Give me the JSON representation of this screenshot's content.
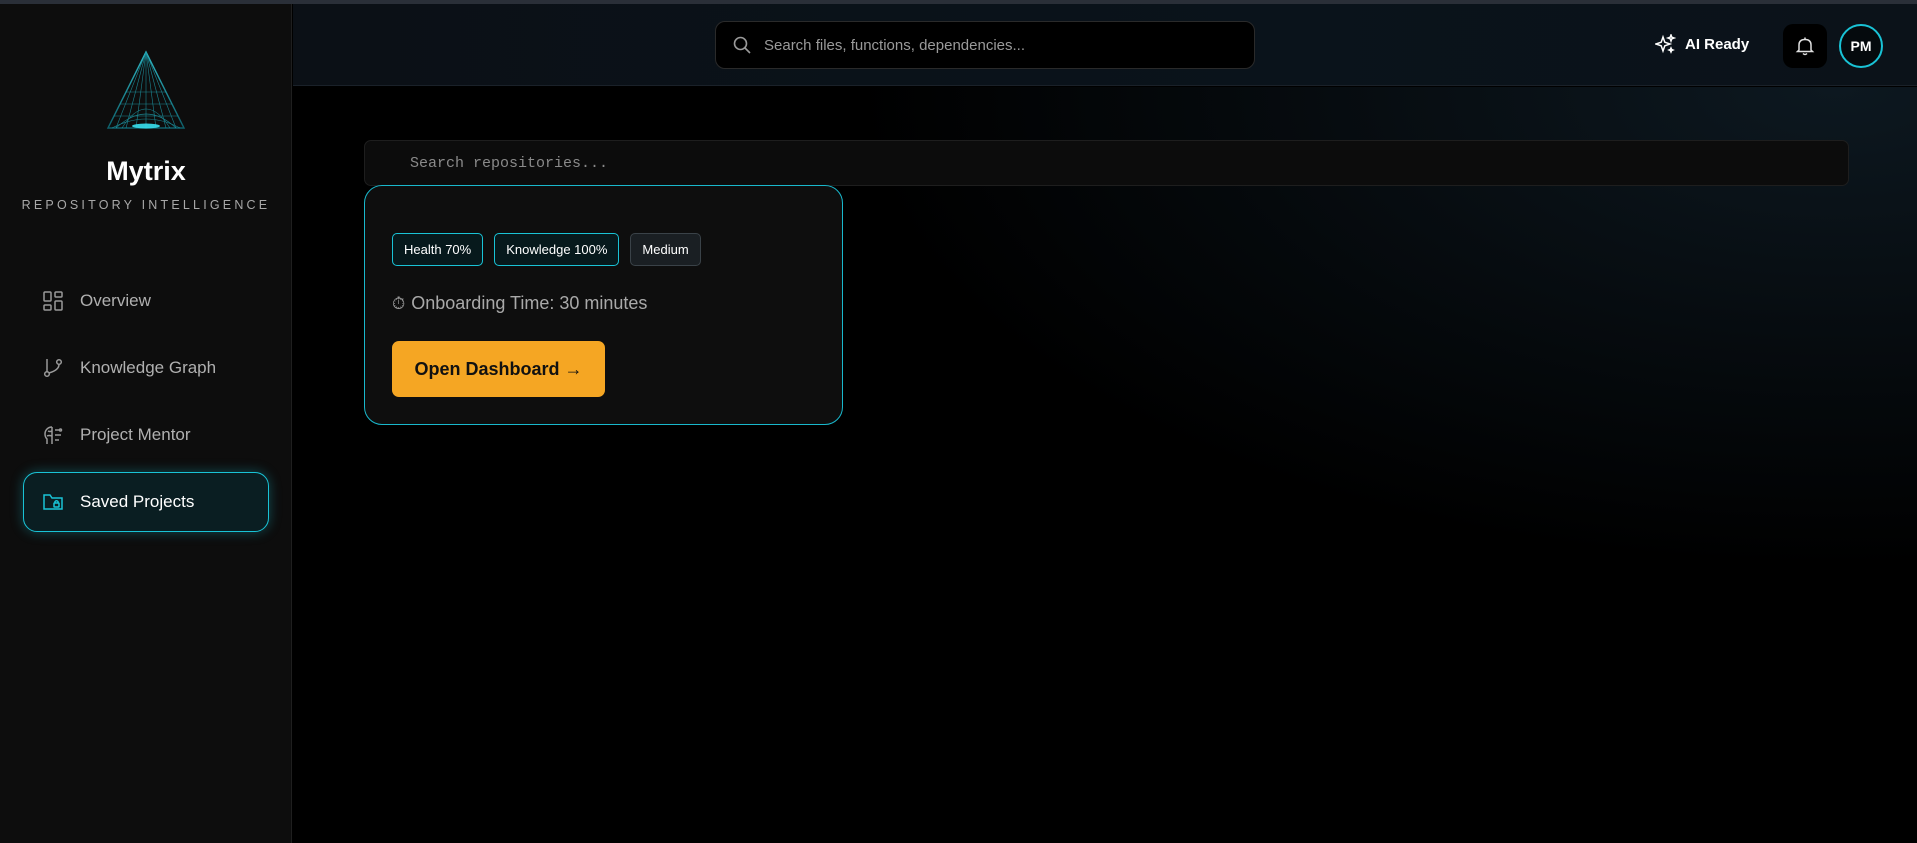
{
  "brand": {
    "name": "Mytrix",
    "tagline": "REPOSITORY INTELLIGENCE",
    "logo_icon": "triangle-pyramid-logo"
  },
  "sidebar": {
    "items": [
      {
        "label": "Overview",
        "icon": "grid-icon",
        "active": false
      },
      {
        "label": "Knowledge Graph",
        "icon": "git-branch-icon",
        "active": false
      },
      {
        "label": "Project Mentor",
        "icon": "brain-icon",
        "active": false
      },
      {
        "label": "Saved Projects",
        "icon": "folder-lock-icon",
        "active": true
      }
    ]
  },
  "header": {
    "search_placeholder": "Search files, functions, dependencies...",
    "ai_status": "AI Ready",
    "avatar_initials": "PM"
  },
  "main": {
    "repo_search_placeholder": "Search repositories...",
    "card": {
      "badges": [
        "Health 70%",
        "Knowledge 100%",
        "Medium"
      ],
      "onboarding_icon": "⏱",
      "onboarding_text": "Onboarding Time: 30 minutes",
      "button_label": "Open Dashboard →"
    }
  },
  "colors": {
    "accent": "#19c3d6",
    "button": "#f5a623",
    "background": "#000000"
  }
}
